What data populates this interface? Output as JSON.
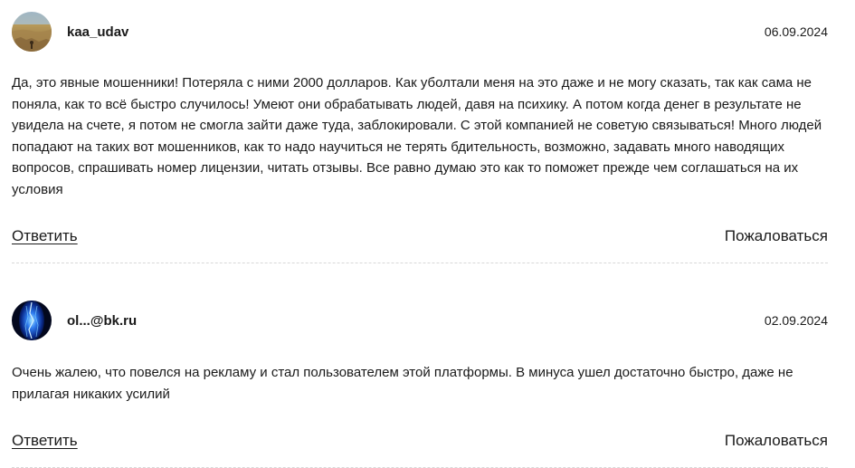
{
  "comments": [
    {
      "username": "kaa_udav",
      "date": "06.09.2024",
      "avatar_icon": "avatar-photo-field",
      "text": "Да, это явные мошенники! Потеряла с ними 2000 долларов. Как уболтали меня на это даже и не могу сказать, так как сама не поняла, как то всё быстро случилось! Умеют они обрабатывать людей, давя на психику. А потом когда денег в результате не увидела на счете, я потом не смогла зайти даже туда, заблокировали. С этой компанией не советую связываться! Много людей попадают на таких вот мошенников, как то надо научиться не терять бдительность, возможно, задавать много наводящих вопросов, спрашивать номер лицензии, читать отзывы. Все равно думаю это как то поможет прежде чем соглашаться на их условия",
      "reply_label": "Ответить",
      "report_label": "Пожаловаться"
    },
    {
      "username": "ol...@bk.ru",
      "date": "02.09.2024",
      "avatar_icon": "avatar-photo-blue-light",
      "text": "Очень жалею, что повелся на рекламу и стал пользователем этой платформы. В минуса ушел достаточно быстро, даже не прилагая никаких усилий",
      "reply_label": "Ответить",
      "report_label": "Пожаловаться"
    }
  ],
  "colors": {
    "text": "#1a1a1a",
    "divider": "#d8d8d8",
    "background": "#ffffff"
  }
}
